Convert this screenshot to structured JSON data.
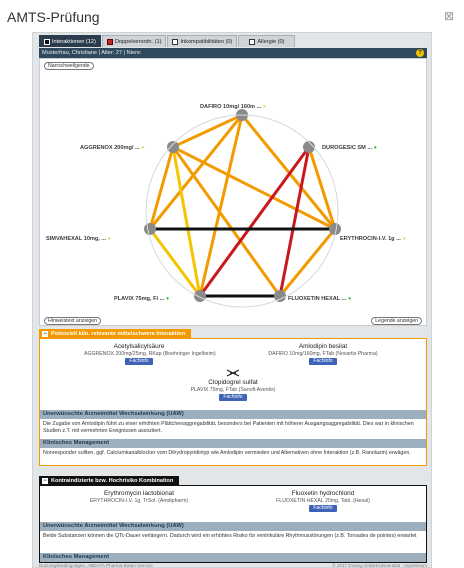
{
  "window": {
    "title": "AMTS-Prüfung",
    "close": "⊠"
  },
  "tabs": [
    {
      "label": "Interaktionen (12)"
    },
    {
      "label": "Doppelverordn. (1)"
    },
    {
      "label": "Inkompatibilitäten (0)"
    },
    {
      "label": "Allergie (0)"
    }
  ],
  "patient": {
    "text": "Musterfrau, Christiane | Alter: 27 | Niere:",
    "help": "?"
  },
  "graph": {
    "legend_button": "Narrschweilgende",
    "show_hints": "Hinweistext anzeigen",
    "show_legend": "Legende anzeigen",
    "drugs": [
      {
        "label": "DAFIRO 10mg/ 160m ..."
      },
      {
        "label": "DUROGESIC SM ..."
      },
      {
        "label": "ERYTHROCIN-I.V. 1g ..."
      },
      {
        "label": "FLUOXETIN HEXAL ..."
      },
      {
        "label": "PLAVIX 75mg, Fi ..."
      },
      {
        "label": "SIMVAHEXAL 10mg, ..."
      },
      {
        "label": "AGGRENOX 200mg/ ..."
      }
    ],
    "colors": {
      "node": "#8a8a8a",
      "severe": "#c8181e",
      "moderate": "#f29a00",
      "minor": "#f5c400",
      "contra": "#111111"
    }
  },
  "section1": {
    "title": "Potenziell klin. relevante mittelschwere Interaktion",
    "drug_left": {
      "name": "Acetylsalicylsäure",
      "detail": "AGGRENOX 200mg/25mg, RKap (Boehringer Ingelheim)",
      "button": "Fachinfo"
    },
    "drug_right": {
      "name": "Amlodipin besilat",
      "detail": "DAFIRO 10mg/160mg, FTab (Novartis Pharma)",
      "button": "Fachinfo"
    },
    "drug_center": {
      "name": "Clopidogrel sulfat",
      "detail": "PLAVIX 75mg, FTab (Sanofi-Aventis)",
      "button": "Fachinfo"
    },
    "uaw_title": "Unerwünschte Arzneimittel Wechselwirkung (UAW)",
    "uaw_text": "Die Zugabe von Amlodipin führt zu einer erhöhten Plättchenaggregabilität, besonders bei Patienten mit höherer Ausgangsaggregabilität. Dies war in klinischen Studien z.T. mit vermehrten Ereignissen assoziiert.",
    "mgmt_title": "Klinisches Management",
    "mgmt_text": "Nonresponder sollten, ggf. Calciumkanalblocker vom Dihydropyridintyp wie Amlodipin vermieden und Alternativen ohne Interaktion (z.B. Ranolazin) erwägen."
  },
  "section2": {
    "title": "Kontraindizierte bzw. Hochrisiko Kombination",
    "drug_left": {
      "name": "Erythromycin lactobionat",
      "detail": "ERYTHROCIN-I.V. 1g, TrSol. (Amdipharm)"
    },
    "drug_right": {
      "name": "Fluoxetin hydrochlorid",
      "detail": "FLUOXETIN HEXAL 20mg, Tabl. (Hexal)",
      "button": "Fachinfo"
    },
    "uaw_title": "Unerwünschte Arzneimittel Wechselwirkung (UAW)",
    "uaw_text": "Beide Substanzen können die QTc-Dauer verlängern. Dadurch wird ein erhöhtes Risiko für ventrikuläre Rhythmusstörungen (z.B. Torsades de pointes) erwartet",
    "mgmt_title": "Klinisches Management"
  },
  "footer": {
    "left": "Nutzungsbedingungen, ABDATA Pharma-Daten-Service",
    "right": "© 2017 Dosing GmbH/Universität · Impressum"
  }
}
